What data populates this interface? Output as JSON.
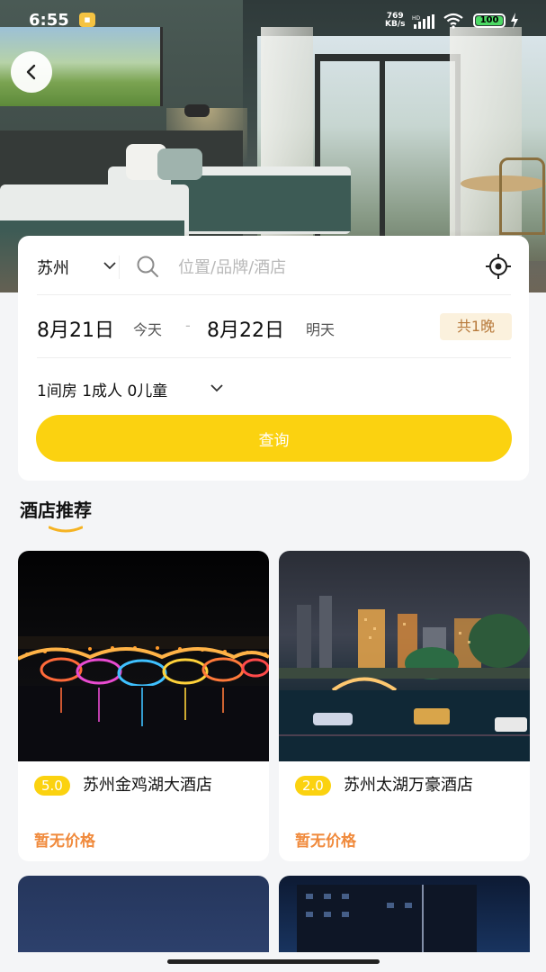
{
  "status_bar": {
    "time": "6:55",
    "net_speed_value": "769",
    "net_speed_unit": "KB/s",
    "hd_label": "HD",
    "battery": "100"
  },
  "search": {
    "city": "苏州",
    "placeholder": "位置/品牌/酒店"
  },
  "dates": {
    "checkin": "8月21日",
    "checkin_tag": "今天",
    "separator": "-",
    "checkout": "8月22日",
    "checkout_tag": "明天",
    "nights": "共1晚"
  },
  "guests": {
    "summary": "1间房 1成人 0儿童"
  },
  "query_button": "查询",
  "section": {
    "title": "酒店推荐"
  },
  "hotels": [
    {
      "rating": "5.0",
      "name": "苏州金鸡湖大酒店",
      "price": "暂无价格"
    },
    {
      "rating": "2.0",
      "name": "苏州太湖万豪酒店",
      "price": "暂无价格"
    }
  ],
  "colors": {
    "accent": "#fbd210",
    "price": "#f08a3c",
    "nights_bg": "#fbf1dd",
    "nights_text": "#b7793a"
  }
}
